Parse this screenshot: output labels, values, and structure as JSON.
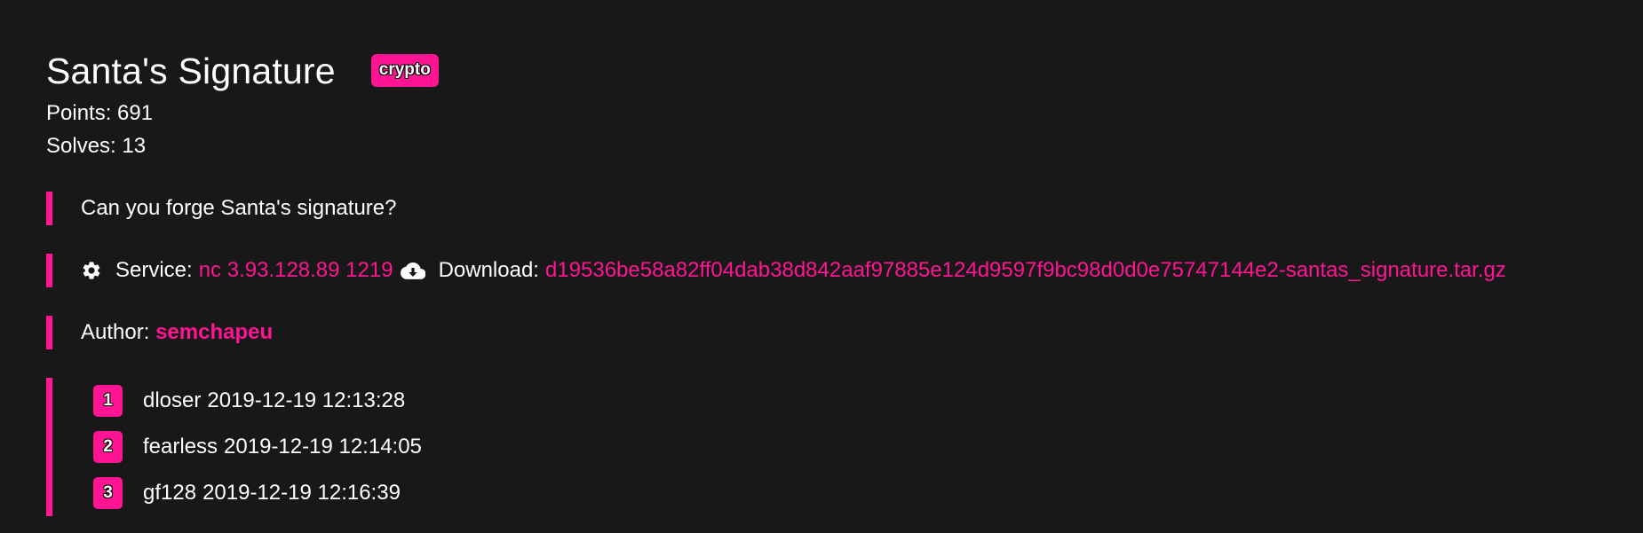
{
  "challenge": {
    "title": "Santa's Signature",
    "category": "crypto",
    "points_label": "Points:",
    "points": "691",
    "solves_label": "Solves:",
    "solves": "13",
    "description": "Can you forge Santa's signature?"
  },
  "service": {
    "label": "Service:",
    "command": "nc 3.93.128.89 1219",
    "icon": "gear-icon"
  },
  "download": {
    "label": "Download:",
    "filename": "d19536be58a82ff04dab38d842aaf97885e124d9597f9bc98d0d0e75747144e2-santas_signature.tar.gz",
    "icon": "cloud-download-icon"
  },
  "author": {
    "label": "Author:",
    "name": "semchapeu"
  },
  "solvers": [
    {
      "rank": "1",
      "name": "dloser",
      "time": "2019-12-19 12:13:28"
    },
    {
      "rank": "2",
      "name": "fearless",
      "time": "2019-12-19 12:14:05"
    },
    {
      "rank": "3",
      "name": "gf128",
      "time": "2019-12-19 12:16:39"
    }
  ],
  "colors": {
    "background": "#181818",
    "accent": "#ff1493",
    "text": "#ffffff"
  }
}
